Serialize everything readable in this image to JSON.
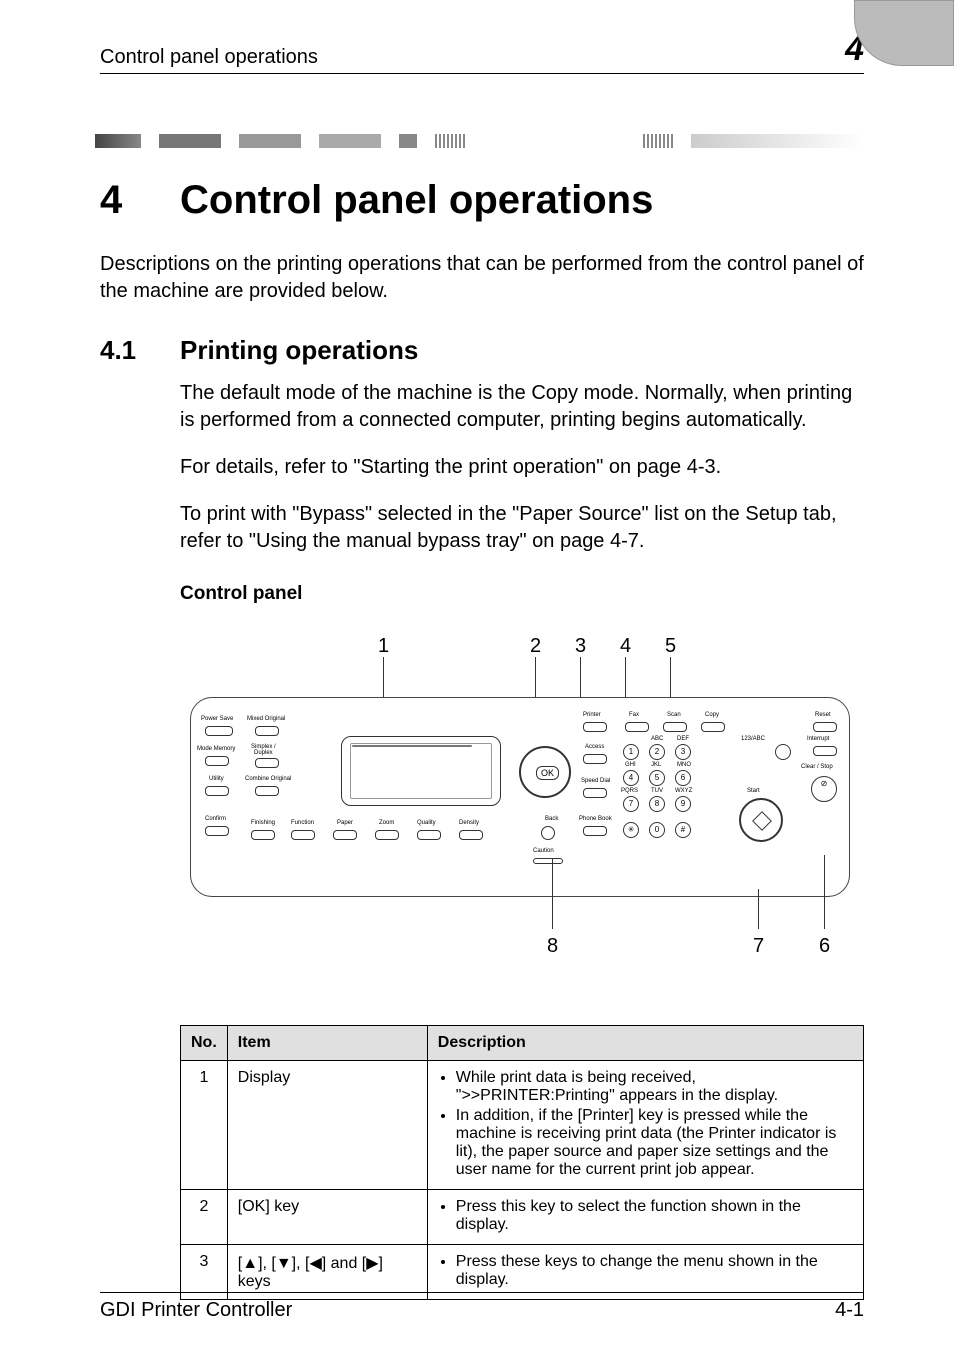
{
  "header": {
    "left": "Control panel operations",
    "num": "4"
  },
  "chapter": {
    "num": "4",
    "title": "Control panel operations"
  },
  "intro": "Descriptions on the printing operations that can be performed from the control panel of the machine are provided below.",
  "section": {
    "num": "4.1",
    "title": "Printing operations"
  },
  "paras": {
    "p1": "The default mode of the machine is the Copy mode. Normally, when printing is performed from a connected computer, printing begins automatically.",
    "p2": "For details, refer to \"Starting the print operation\" on page 4-3.",
    "p3": "To print with \"Bypass\" selected in the \"Paper Source\" list on the Setup tab, refer to \"Using the manual bypass tray\" on page 4-7."
  },
  "cp_label": "Control panel",
  "callouts": {
    "top": [
      "1",
      "2",
      "3",
      "4",
      "5"
    ],
    "bot": [
      "8",
      "7",
      "6"
    ]
  },
  "panel_labels": {
    "power_save": "Power Save",
    "mixed": "Mixed Original",
    "mode_mem": "Mode Memory",
    "simplex": "Simplex /\nDuplex",
    "utility": "Utility",
    "combine": "Combine Original",
    "confirm": "Confirm",
    "finishing": "Finishing",
    "function": "Function",
    "paper": "Paper",
    "zoom": "Zoom",
    "quality": "Quality",
    "density": "Density",
    "access": "Access",
    "speed": "Speed Dial",
    "phone": "Phone Book",
    "back": "Back",
    "caution": "Caution",
    "printer": "Printer",
    "fax": "Fax",
    "scan": "Scan",
    "copy": "Copy",
    "reset": "Reset",
    "n123": "123/ABC",
    "interrupt": "Interrupt",
    "start": "Start",
    "clear": "Clear / Stop",
    "ok": "OK",
    "keypad": {
      "abc": "ABC",
      "def": "DEF",
      "ghi": "GHI",
      "jkl": "JKL",
      "mno": "MNO",
      "pqrs": "PQRS",
      "tuv": "TUV",
      "wxyz": "WXYZ"
    }
  },
  "table": {
    "headers": {
      "no": "No.",
      "item": "Item",
      "desc": "Description"
    },
    "rows": [
      {
        "no": "1",
        "item": "Display",
        "desc": [
          "While print data is being received, \">>PRINTER:Printing\" appears in the display.",
          "In addition, if the [Printer] key is pressed while the machine is receiving print data (the Printer indicator is lit), the paper source and paper size settings and the user name for the current print job appear."
        ]
      },
      {
        "no": "2",
        "item": "[OK] key",
        "desc": [
          "Press this key to select the function shown in the display."
        ]
      },
      {
        "no": "3",
        "item": "[▲], [▼], [◀] and [▶] keys",
        "desc": [
          "Press these keys to change the menu shown in the display."
        ]
      }
    ]
  },
  "footer": {
    "left": "GDI Printer Controller",
    "right": "4-1"
  },
  "chart_data": null
}
